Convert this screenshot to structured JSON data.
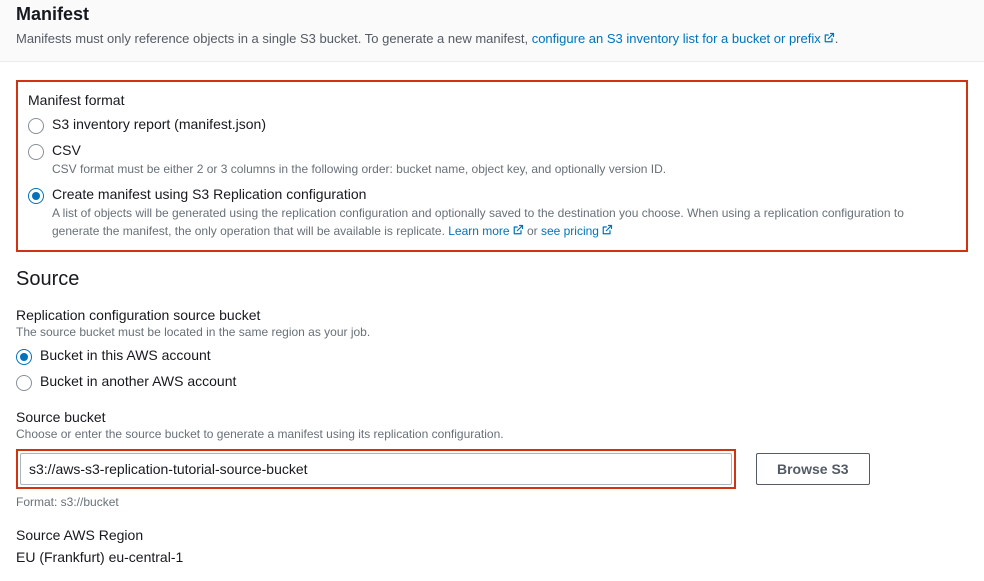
{
  "header": {
    "title": "Manifest",
    "desc_prefix": "Manifests must only reference objects in a single S3 bucket. To generate a new manifest, ",
    "desc_link": "configure an S3 inventory list for a bucket or prefix",
    "desc_suffix": "."
  },
  "manifest_format": {
    "label": "Manifest format",
    "options": [
      {
        "label": "S3 inventory report (manifest.json)",
        "hint": "",
        "selected": false
      },
      {
        "label": "CSV",
        "hint": "CSV format must be either 2 or 3 columns in the following order: bucket name, object key, and optionally version ID.",
        "selected": false
      },
      {
        "label": "Create manifest using S3 Replication configuration",
        "hint_prefix": "A list of objects will be generated using the replication configuration and optionally saved to the destination you choose. When using a replication configuration to generate the manifest, the only operation that will be available is replicate. ",
        "learn_more": "Learn more",
        "hint_or": " or ",
        "see_pricing": "see pricing",
        "selected": true
      }
    ]
  },
  "source": {
    "title": "Source",
    "replication_bucket": {
      "label": "Replication configuration source bucket",
      "hint": "The source bucket must be located in the same region as your job.",
      "options": [
        {
          "label": "Bucket in this AWS account",
          "selected": true
        },
        {
          "label": "Bucket in another AWS account",
          "selected": false
        }
      ]
    },
    "source_bucket": {
      "label": "Source bucket",
      "hint": "Choose or enter the source bucket to generate a manifest using its replication configuration.",
      "value": "s3://aws-s3-replication-tutorial-source-bucket",
      "browse_label": "Browse S3",
      "format_hint": "Format: s3://bucket"
    },
    "region": {
      "label": "Source AWS Region",
      "value": "EU (Frankfurt) eu-central-1"
    }
  }
}
